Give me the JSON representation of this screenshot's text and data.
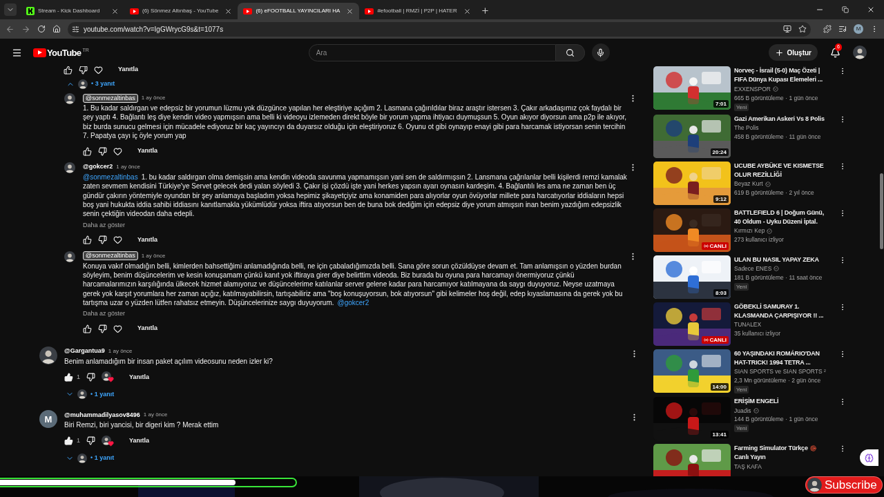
{
  "browser": {
    "tabs": [
      {
        "title": "Stream - Kick Dashboard",
        "kind": "kick",
        "selected": false
      },
      {
        "title": "(6) Sönmez Altınbaş - YouTube",
        "kind": "youtube",
        "selected": false
      },
      {
        "title": "(6) eFOOTBALL YAYINCILARI HA",
        "kind": "youtube",
        "selected": true
      },
      {
        "title": "#efootball | RMZİ | P2P | HATER",
        "kind": "youtube",
        "selected": false
      }
    ],
    "url": "youtube.com/watch?v=IgGWrycG9s&t=1077s",
    "profile_letter": "M"
  },
  "header": {
    "logo": "YouTube",
    "region": "TR",
    "search_placeholder": "Ara",
    "create_label": "Oluştur",
    "notification_count": "6"
  },
  "comments": {
    "parent_actions": {
      "reply_label": "Yanıtla",
      "liked": false
    },
    "thread_toggle": {
      "label": "• 3 yanıt",
      "expanded": true
    },
    "replies": [
      {
        "author": "@sonmezaltinbas",
        "creator": true,
        "time": "1 ay önce",
        "text": "1. Bu kadar saldırgan ve edepsiz bir yorumun lüzmu yok düzgünce yapılan her eleştiriye açığım 2. Lasmana çağırıldılar biraz araştır istersen 3. Çakır arkadaşımız çok faydalı bir şey yaptı 4. Bağlantı leş diye kendin video yapmışsın ama belli ki videoyu izlemeden direkt böyle bir yorum yapma ihtiyacı duymuşsun 5. Oyun akıyor diyorsun ama p2p ile akıyor, biz burda sunucu gelmesi için mücadele ediyoruz bir kaç yayıncıyı da duyarsız olduğu için eleştiriyoruz 6. Oyunu ot gibi oynayıp enayi gibi para harcamak istiyorsan senin tercihin 7. Papatya çayı iç öyle yorum yap",
        "reply_label": "Yanıtla",
        "liked": false
      },
      {
        "author": "@gokcer2",
        "creator": false,
        "time": "1 ay önce",
        "mention_before": "@sonmezaltinbas",
        "text": "1. bu kadar saldırgan olma demişsin ama kendin videoda savunma yapmamışsın yani sen de saldırmışsın 2. Lansmana çağrılanlar belli kişilerdi remzi kamalak zaten sevmem kendisini Türkiye'ye Servet gelecek dedi yalan söyledi 3. Çakır işi çözdü işte yani herkes yapsın ayarı oynasın kardeşim. 4. Bağlantılı les ama ne zaman ben üç gündür çakırın yöntemiyle oyundan bir şey anlamaya başladım yoksa hepimiz şikayetçiyiz ama konamiden para alıyorlar oyun övüyorlar millete para harcatıyorlar iddiaların hepsi boş yani hukukta iddia sahibi iddiasını kanıtlamakla yükümlüdür yoksa iftira atıyorsun ben de buna bok dediğim için edepsiz diye yorum atmışsın inan benim yazdığım edepsizlik senin çektiğin videodan daha edepli.",
        "show_less": "Daha az göster",
        "reply_label": "Yanıtla",
        "liked": false
      },
      {
        "author": "@sonmezaltinbas",
        "creator": true,
        "time": "1 ay önce",
        "text": "Konuya vakıf olmadığın belli, kimlerden bahsettiğimi anlamadığında belli, ne için çabaladığımızda belli. Sana göre sorun çözüldüyse devam et. Tam anlamışsın o yüzden burdan söyleyim, benim düşüncelerim ve kesin konuşamam çünkü kanıt yok iftiraya girer diye belirttim videoda. Biz burada bu oyuna para harcamayı önermiyoruz çünkü harcamalarımızın karşılığında ülkecek hizmet alamıyoruz ve düşüncelerime katılanlar server gelene kadar para harcamıyor katılmayana da saygı duyuyoruz. Neyse uzatmaya gerek yok karşıt yorumlara her zaman açığız, katılmayabilirsin, tartışabiliriz ama \"boş konuşuyorsun, bok atıyorsun\" gibi kelimeler hoş değil, edep kıyaslamasına da gerek yok bu tartışma uzar o yüzden lütfen rahatsız etmeyin. Düşüncelerinize saygı duyuyorum.",
        "mention_after": "@gokcer2",
        "show_less": "Daha az göster",
        "reply_label": "Yanıtla",
        "liked": false
      }
    ],
    "threads": [
      {
        "author": "@Gargantua9",
        "time": "1 ay önce",
        "text": "Benim anlamadığım bir insan paket açılım videosunu neden izler ki?",
        "likes": "1",
        "liked": true,
        "creator_heart": true,
        "reply_label": "Yanıtla",
        "replies_toggle": {
          "label": "• 1 yanıt",
          "expanded": false
        }
      },
      {
        "author": "@muhammadilyasov8496",
        "avatar_letter": "M",
        "time": "1 ay önce",
        "text": "Biri Remzi, biri yancisi, bir digeri kim ? Merak ettim",
        "likes": "1",
        "liked": true,
        "creator_heart": true,
        "reply_label": "Yanıtla",
        "replies_toggle": {
          "label": "• 1 yanıt",
          "expanded": false
        }
      }
    ]
  },
  "sidebar": {
    "videos": [
      {
        "title_lines": [
          "Norveç - İsrail (5-0) Maç Özeti |",
          "FIFA Dünya Kupası Elemeleri ..."
        ],
        "channel": "EXXENSPOR",
        "verified": true,
        "meta": "665 B görüntüleme · 1 gün önce",
        "new_label": "Yeni",
        "badge": {
          "kind": "duration",
          "text": "7:01"
        }
      },
      {
        "title_lines": [
          "Gazi Amerikan Askeri Vs 8 Polis"
        ],
        "channel": "The Polis",
        "verified": false,
        "meta": "458 B görüntüleme · 11 gün önce",
        "badge": {
          "kind": "duration",
          "text": "20:24"
        }
      },
      {
        "title_lines": [
          "UCUBE AYBÜKE VE KISMETSE",
          "OLUR REZİLLİĞİ"
        ],
        "channel": "Beyaz Kurt",
        "verified": true,
        "meta": "619 B görüntüleme · 2 yıl önce",
        "badge": {
          "kind": "duration",
          "text": "9:12"
        }
      },
      {
        "title_lines": [
          "BATTLEFIELD 6 | Doğum Günü,",
          "40 Oldum - Uyku Düzeni İptal."
        ],
        "channel": "Kırmızı Kep",
        "verified": true,
        "meta": "273 kullanıcı izliyor",
        "badge": {
          "kind": "live",
          "text": "CANLI"
        }
      },
      {
        "title_lines": [
          "ULAN BU NASIL YAPAY ZEKA"
        ],
        "channel": "Sadece ENES",
        "verified": true,
        "meta": "181 B görüntüleme · 11 saat önce",
        "new_label": "Yeni",
        "badge": {
          "kind": "duration",
          "text": "8:03"
        }
      },
      {
        "title_lines": [
          "GÖBEKLİ SAMURAY 1.",
          "KLASMANDA ÇARPIŞIYOR !! ..."
        ],
        "channel": "TUNALEX",
        "verified": false,
        "meta": "35 kullanıcı izliyor",
        "badge": {
          "kind": "live",
          "text": "CANLI"
        }
      },
      {
        "title_lines": [
          "60 YAŞINDAKI ROMÁRIO'DAN",
          "HAT-TRICK! 1994 TETRA ..."
        ],
        "channel": "SIAN SPORTS ve SIAN SPORTS ²",
        "verified": false,
        "meta": "2,3 Mn görüntüleme · 2 gün önce",
        "new_label": "Yeni",
        "badge": {
          "kind": "duration",
          "text": "14:00"
        }
      },
      {
        "title_lines": [
          "ERİŞİM ENGELİ"
        ],
        "channel": "Juadis",
        "verified": true,
        "meta": "144 B görüntüleme · 1 gün önce",
        "new_label": "Yeni",
        "badge": {
          "kind": "duration",
          "text": "13:41"
        }
      },
      {
        "title_lines": [
          "Farming Simulator Türkçe",
          "Canlı Yayın"
        ],
        "title_emoji": true,
        "channel": "TAŞ KAFA",
        "verified": false
      }
    ]
  },
  "stream_overlay": {
    "level": 0.8,
    "subscribe_label": "Subscribe"
  }
}
